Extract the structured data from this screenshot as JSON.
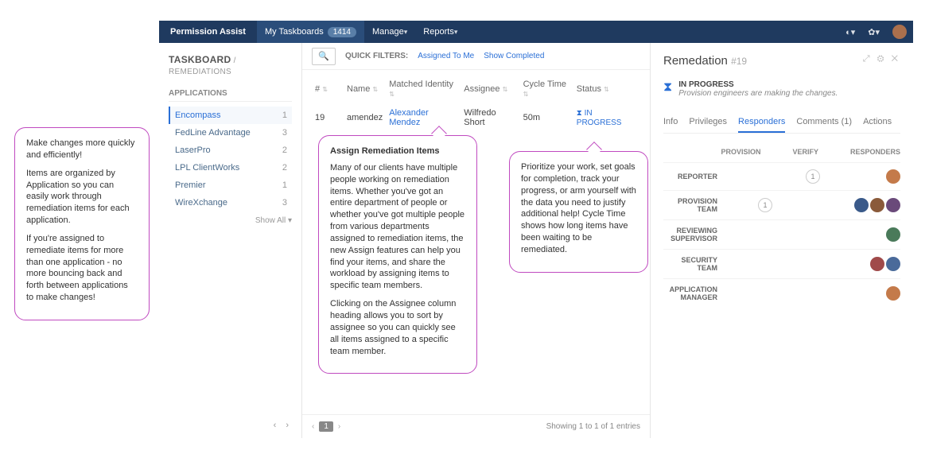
{
  "topbar": {
    "brand": "Permission Assist",
    "my_taskboards": "My Taskboards",
    "my_taskboards_count": "1414",
    "manage": "Manage",
    "reports": "Reports"
  },
  "sidebar": {
    "title": "TASKBOARD",
    "crumb": " / REMEDIATIONS",
    "section": "APPLICATIONS",
    "apps": [
      {
        "name": "Encompass",
        "count": "1",
        "selected": true
      },
      {
        "name": "FedLine Advantage",
        "count": "3"
      },
      {
        "name": "LaserPro",
        "count": "2"
      },
      {
        "name": "LPL ClientWorks",
        "count": "2"
      },
      {
        "name": "Premier",
        "count": "1"
      },
      {
        "name": "WireXchange",
        "count": "3"
      }
    ],
    "show_all": "Show All  ▾"
  },
  "filters": {
    "label": "QUICK FILTERS:",
    "assigned": "Assigned To Me",
    "completed": "Show Completed"
  },
  "table": {
    "cols": [
      "#",
      "Name",
      "Matched Identity",
      "Assignee",
      "Cycle Time",
      "Status"
    ],
    "rows": [
      {
        "num": "19",
        "name": "amendez",
        "identity": "Alexander Mendez",
        "assignee": "Wilfredo Short",
        "cycle": "50m",
        "status": "IN PROGRESS"
      }
    ],
    "footer_showing": "Showing 1 to 1 of 1 entries",
    "page": "1"
  },
  "detail": {
    "title": "Remedation",
    "idnum": "#19",
    "status_title": "IN PROGRESS",
    "status_sub": "Provision engineers are making the changes.",
    "tabs": [
      "Info",
      "Privileges",
      "Responders",
      "Comments (1)",
      "Actions"
    ],
    "active_tab": 2,
    "resp_head_left": "PROVISION",
    "resp_head_mid": "VERIFY",
    "resp_head_right": "RESPONDERS",
    "roles": [
      {
        "role": "REPORTER",
        "provision": "",
        "verify": "1",
        "responders": 1
      },
      {
        "role": "PROVISION TEAM",
        "provision": "1",
        "verify": "",
        "responders": 3
      },
      {
        "role": "REVIEWING SUPERVISOR",
        "provision": "",
        "verify": "",
        "responders": 1
      },
      {
        "role": "SECURITY TEAM",
        "provision": "",
        "verify": "",
        "responders": 2
      },
      {
        "role": "APPLICATION MANAGER",
        "provision": "",
        "verify": "",
        "responders": 1
      }
    ]
  },
  "callouts": {
    "left": [
      "Make changes more quickly and efficiently!",
      "Items are organized by Application so you can easily work through remediation items for each application.",
      "If you're assigned to remediate items for more than one application - no more bouncing back and forth between applications to make changes!"
    ],
    "mid_title": "Assign Remediation Items",
    "mid": [
      "Many of our clients have multiple people working on remediation items. Whether you've got an entire department of people or whether you've got multiple people from various departments assigned to remediation items, the new Assign features can help you find your items, and share the workload by assigning items to specific team members.",
      "Clicking on the Assignee column heading allows you to sort by assignee so you can quickly see all items assigned to a specific team member."
    ],
    "right": [
      "Prioritize your work, set goals for completion, track your progress, or arm yourself with the data you need to justify additional help! Cycle Time shows how long items have been waiting to be remediated."
    ]
  }
}
